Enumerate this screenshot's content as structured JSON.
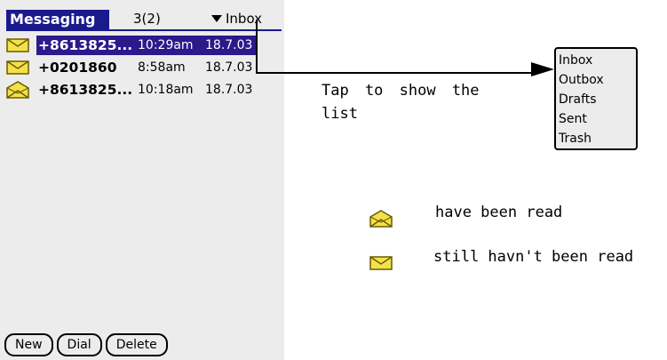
{
  "app": {
    "title": "Messaging",
    "count": "3(2)",
    "folder": "Inbox"
  },
  "messages": [
    {
      "sender": "+8613825...",
      "time": "10:29am",
      "date": "18.7.03",
      "read": false,
      "selected": true
    },
    {
      "sender": "+0201860",
      "time": "8:58am",
      "date": "18.7.03",
      "read": false,
      "selected": false
    },
    {
      "sender": "+8613825...",
      "time": "10:18am",
      "date": "18.7.03",
      "read": true,
      "selected": false
    }
  ],
  "buttons": {
    "new": "New",
    "dial": "Dial",
    "delete": "Delete"
  },
  "annotations": {
    "tap_line1": "Tap to show the",
    "tap_line2": "list",
    "read_label": "have been read",
    "unread_label": "still havn't been read"
  },
  "folder_list": [
    "Inbox",
    "Outbox",
    "Drafts",
    "Sent",
    "Trash"
  ],
  "icons": {
    "unread": "unread-envelope-icon",
    "read": "read-envelope-icon"
  },
  "colors": {
    "title_bar": "#1a1a8c",
    "selection": "#2a1a8c",
    "screen_bg": "#ececec",
    "envelope_fill": "#f2e24a",
    "envelope_stroke": "#6b5a00"
  }
}
